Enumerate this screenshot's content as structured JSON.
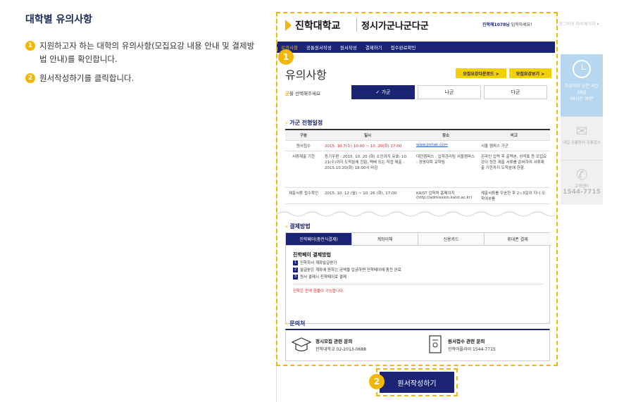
{
  "guide": {
    "title": "대학별 유의사항",
    "step1_num": "1",
    "step1_text": "지원하고자 하는 대학의 유의사항(모집요강 내용 안내 및 결제방법 안내)를 확인합니다.",
    "step2_num": "2",
    "step2_text": "원서작성하기를 클릭합니다."
  },
  "header": {
    "logo": "진학대학교",
    "logo_sub": "정시가군나군다군",
    "user_prefix": "진학해1078님",
    "user_suffix": " 입학하세요!",
    "right_links": "| 로그아웃  마이페이지 ▾"
  },
  "nav": {
    "items": [
      "유의사항",
      "공통원서작성",
      "원서작성",
      "결제하기",
      "접수완료확인"
    ]
  },
  "page": {
    "title": "유의사항",
    "btn_download": "모집요강다운로드 >",
    "btn_view": "모집요강보기 >",
    "select_label_prefix": "군",
    "select_label_suffix": "을 선택해주세요",
    "tabs": [
      "✓ 가군",
      "나군",
      "다군"
    ]
  },
  "schedule": {
    "heading": "가군 전형일정",
    "headers": [
      "구분",
      "일시",
      "장소",
      "비고"
    ],
    "rows": [
      [
        "원서접수",
        "2015. 10.7(수) 10:00 ~ 10. 20(화) 17:00",
        "www.jinhak.com",
        "서울 캠퍼스 가군"
      ],
      [
        "서류제출 기한",
        "등기우편 : 2015. 10. 20 (화) 소인까지 유효, 10. 21(수)까지 도착분에 한함, 택배 또는 직접 제출 : 2015.10.20(화) 18:00시 마감",
        "대전캠퍼스 : 입학관리팀 서울캠퍼스 : 경영대학 교학팀",
        "온라인 입력 후 출력본, 성적표 등 모집요강이 정한 제출 서류를 준비하여 서류제출 기한까지 도착분에 한함."
      ],
      [
        "제출서류 접수확인",
        "2015. 10. 12 (월) ~ 10. 26 (화), 17:00",
        "KAIST 입학처 홈페이지 (http://admission.kaist.ac.kr)",
        "제출서류를 우송한 후 2~3일이 지나 도착여부를"
      ]
    ]
  },
  "payment": {
    "heading": "결제방법",
    "tabs": [
      "진학페이(충전식결제)",
      "계좌이체",
      "신용카드",
      "휴대폰 결제"
    ],
    "sub_title": "진학페이 결제방법",
    "steps": [
      {
        "n": "1",
        "text": "진학하서 계좌발급받기"
      },
      {
        "n": "2",
        "text": "발급받은 계좌에 원하는 금액을 입금하면 진학페이에 충전 완료"
      },
      {
        "n": "3",
        "text": "원서 결제시 진학페이로 결제"
      }
    ],
    "note": "진학은 전액 환불이 가능합니다."
  },
  "contact": {
    "heading": "문의처",
    "items": [
      {
        "title": "정시모집 관련 문의",
        "detail": "진학대학교 02-2013-0688"
      },
      {
        "title": "원서접수 관련 문의",
        "detail": "진학어플라이 1544-7715"
      }
    ]
  },
  "cta": {
    "bubble": "2",
    "label": "원서작성하기",
    "bubble1": "1"
  },
  "sidebar": {
    "timer_label": "마감까지 남은 시간",
    "timer_days": "18일",
    "timer_time": "06시간 30분",
    "item1": "대입 공통원서 공통접수",
    "item2": "고객센터",
    "phone": "1544-7715"
  },
  "colors": {
    "navy": "#1b2473",
    "accent_yellow": "#f2b705",
    "red": "#e02020"
  }
}
